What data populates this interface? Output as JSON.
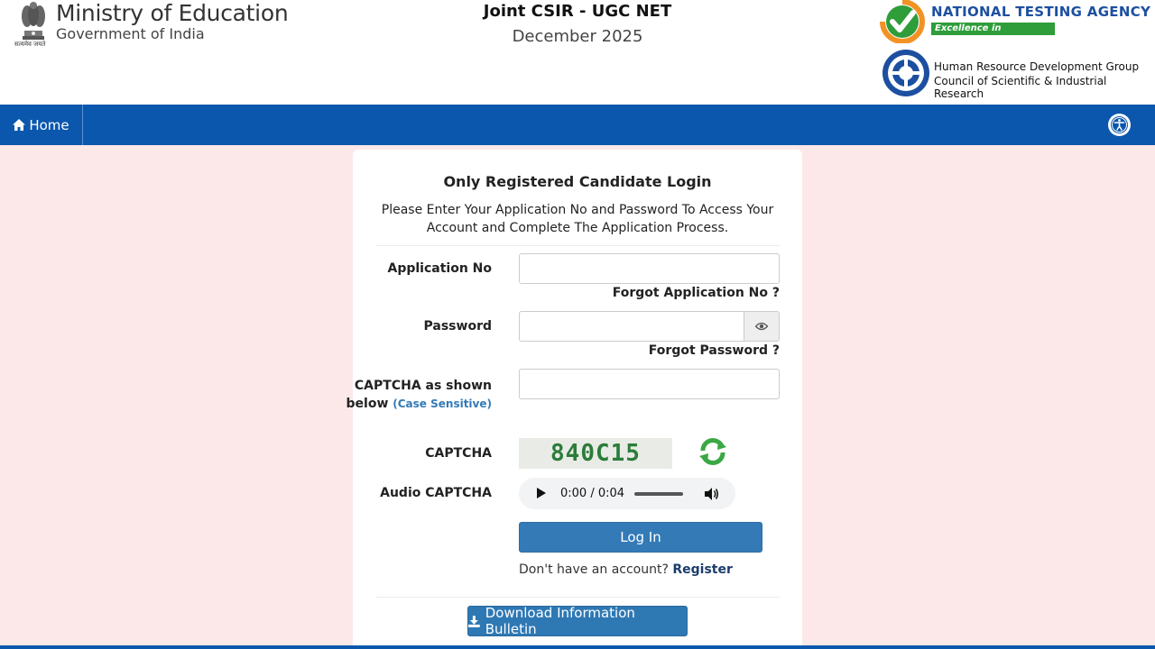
{
  "header": {
    "ministry_title": "Ministry of Education",
    "ministry_sub": "Government of India",
    "emblem_caption": "सत्यमेव जयते",
    "exam_title": "Joint CSIR - UGC NET",
    "exam_sub": "December 2025",
    "nta_name": "NATIONAL TESTING AGENCY",
    "nta_tagline": "Excellence in Assessment",
    "csir_line1": "Human Resource Development Group",
    "csir_line2": "Council of Scientific & Industrial Research"
  },
  "nav": {
    "home_label": "Home"
  },
  "login": {
    "title": "Only Registered Candidate Login",
    "description": "Please Enter Your Application No and Password To Access Your Account and Complete The Application Process.",
    "application_no_label": "Application No",
    "application_no_value": "",
    "forgot_application_no": "Forgot Application No ?",
    "password_label": "Password",
    "password_value": "",
    "forgot_password": "Forgot Password ?",
    "captcha_input_label": "CAPTCHA as shown below",
    "captcha_case_note": "(Case Sensitive)",
    "captcha_value": "",
    "captcha_label": "CAPTCHA",
    "captcha_text": "840C15",
    "audio_captcha_label": "Audio CAPTCHA",
    "audio_time": "0:00 / 0:04",
    "login_button": "Log In",
    "no_account_text": "Don't have an account?",
    "register_link": "Register",
    "download_button": "Download Information Bulletin"
  },
  "colors": {
    "navbar": "#0a57ad",
    "page_bg": "#fce8e9",
    "primary_button": "#337ab7",
    "nta_blue": "#1d4fa0",
    "nta_green": "#2e9d3a"
  }
}
